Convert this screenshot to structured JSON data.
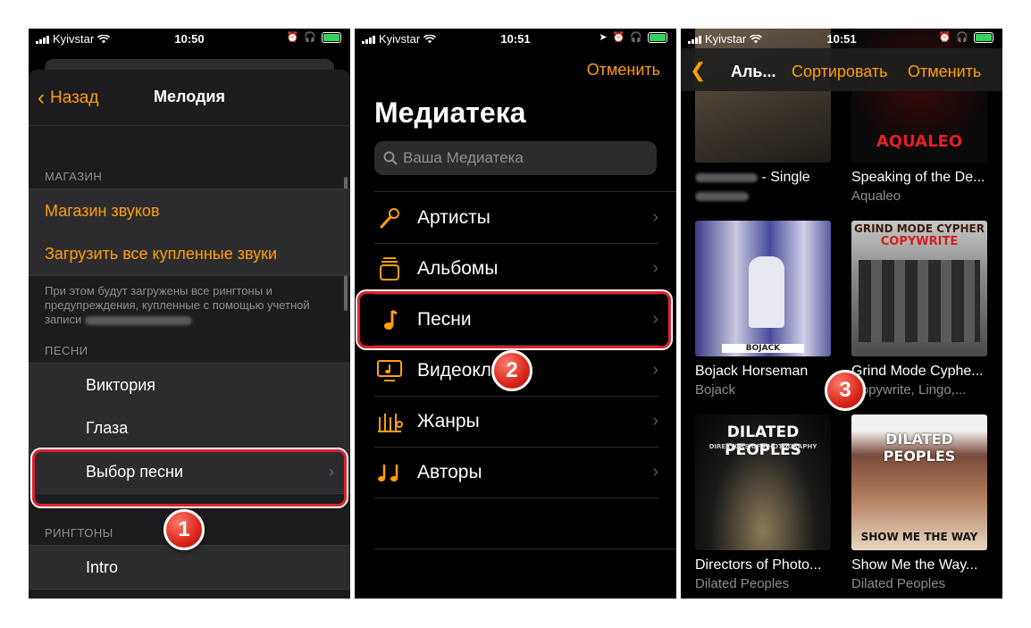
{
  "status": [
    {
      "carrier": "Kyivstar",
      "time": "10:50"
    },
    {
      "carrier": "Kyivstar",
      "time": "10:51"
    },
    {
      "carrier": "Kyivstar",
      "time": "10:51"
    }
  ],
  "screen1": {
    "back_label": "Назад",
    "title": "Мелодия",
    "store_header": "МАГАЗИН",
    "store_items": [
      "Магазин звуков",
      "Загрузить все купленные звуки"
    ],
    "note": "При этом будут загружены все рингтоны и предупреждения, купленные с помощью учетной записи",
    "songs_header": "ПЕСНИ",
    "songs": [
      "Виктория",
      "Глаза",
      "Выбор песни"
    ],
    "ringtones_header": "РИНГТОНЫ",
    "ringtones": [
      "Intro"
    ],
    "badge": "1"
  },
  "screen2": {
    "cancel": "Отменить",
    "title": "Медиатека",
    "search_placeholder": "Ваша Медиатека",
    "items": [
      {
        "label": "Артисты",
        "icon": "microphone-icon"
      },
      {
        "label": "Альбомы",
        "icon": "album-icon"
      },
      {
        "label": "Песни",
        "icon": "music-note-icon"
      },
      {
        "label": "Видеоклипы",
        "icon": "video-icon"
      },
      {
        "label": "Жанры",
        "icon": "genres-icon"
      },
      {
        "label": "Авторы",
        "icon": "composers-icon"
      }
    ],
    "badge": "2"
  },
  "screen3": {
    "title": "Аль...",
    "sort": "Сортировать",
    "cancel": "Отменить",
    "albums": [
      {
        "name": "- Single",
        "artist": ""
      },
      {
        "name": "Speaking of the De...",
        "artist": "Aqualeo",
        "cover_text": "AQUALEO"
      },
      {
        "name": "Bojack Horseman",
        "artist": "Bojack",
        "cover_text": "BOJACK"
      },
      {
        "name": "Grind Mode Cyphe...",
        "artist": "Copywrite, Lingo,...",
        "cover_text": "GRIND MODE CYPHER",
        "cover_text2": "COPYWRITE"
      },
      {
        "name": "Directors of Photo...",
        "artist": "Dilated Peoples",
        "cover_text": "DILATED PEOPLES",
        "cover_text2": "DIRECTORS OF PHOTOGRAPHY"
      },
      {
        "name": "Show Me the Way...",
        "artist": "Dilated Peoples",
        "cover_text": "DILATED PEOPLES",
        "cover_text2": "SHOW ME THE WAY"
      }
    ],
    "badge": "3"
  },
  "colors": {
    "accent": "#ff9f0a",
    "highlight": "#e0212e",
    "background": "#000000"
  }
}
